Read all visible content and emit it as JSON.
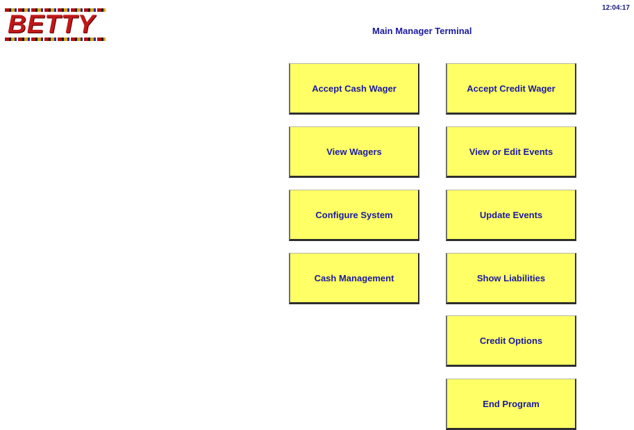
{
  "app": {
    "logo_text": "BETTY",
    "clock": "12:04:17",
    "title": "Main Manager Terminal"
  },
  "buttons": {
    "accept_cash_wager": "Accept Cash Wager",
    "accept_credit_wager": "Accept Credit Wager",
    "view_wagers": "View Wagers",
    "view_or_edit_events": "View or Edit Events",
    "configure_system": "Configure System",
    "update_events": "Update Events",
    "cash_management": "Cash Management",
    "show_liabilities": "Show Liabilities",
    "credit_options": "Credit Options",
    "end_program": "End Program"
  },
  "colors": {
    "button_fill": "#ffff66",
    "text_blue": "#1a1aa0",
    "logo_red": "#c01818"
  }
}
